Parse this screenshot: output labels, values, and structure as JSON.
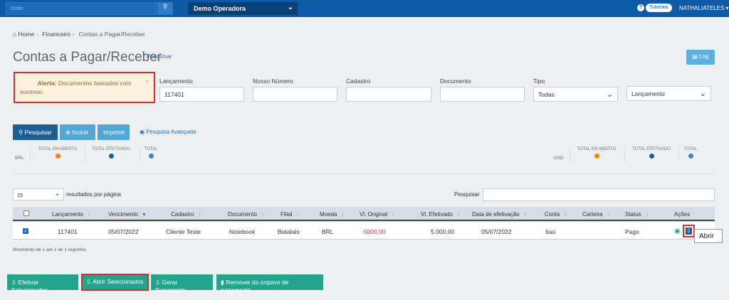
{
  "topbar": {
    "search_placeholder": "Order",
    "operadora": "Demo Operadora",
    "tutorial": "Tutoriais",
    "user": "NATHALIATELES"
  },
  "breadcrumb": [
    "Home",
    "Financeiro",
    "Contas a Pagar/Receber"
  ],
  "page": {
    "title": "Contas a Pagar/Receber",
    "pesquisar_link": "Pesquisar",
    "log_label": "Log"
  },
  "alert": {
    "strong": "Alerta:",
    "message": "Documentos baixados com",
    "message2": "sucesso."
  },
  "filters": {
    "lancamento_label": "Lançamento",
    "lancamento_value": "117401",
    "nosso_numero_label": "Nosso Número",
    "cadastro_label": "Cadastro",
    "documento_label": "Documento",
    "tipo_label": "Tipo",
    "tipo_value": "Todas",
    "ordem_value": "Lançamento"
  },
  "actions": {
    "pesquisar": "Pesquisar",
    "incluir": "Incluir",
    "imprimir": "Imprimir",
    "avancada": "Pesquisa Avançada"
  },
  "totals": {
    "brl": "BRL",
    "usd": "USD",
    "em_aberto": "TOTAL EM ABERTO",
    "efetivado": "TOTAL EFETIVADO",
    "total": "TOTAL"
  },
  "table_controls": {
    "page_size": "25",
    "per_page": "resultados por página",
    "search_label": "Pesquisar"
  },
  "table": {
    "headers": [
      "Lançamento",
      "Vencimento",
      "Cadastro",
      "Documento",
      "Filial",
      "Moeda",
      "Vl. Original",
      "Vl. Efetivado",
      "Data de efetivação",
      "Conta",
      "Carteira",
      "Status",
      "Ações"
    ],
    "row": {
      "lancamento": "117401",
      "vencimento": "05/07/2022",
      "cadastro": "Cliente Teste",
      "documento": "Notebook",
      "filial": "Batatais",
      "moeda": "BRL",
      "vl_original": "-5000,00",
      "vl_efetivado": "5.000,00",
      "data_efetivacao": "05/07/2022",
      "conta": "Itaú",
      "carteira": "",
      "status": "Pago"
    },
    "tooltip": "Abrir",
    "showing": "Mostrando de 1 até 1 de 1 registros"
  },
  "bottom": {
    "efetivar": "Efetivar Selecionados",
    "abrir": "Abrir Selecionados",
    "gerar": "Gerar Pagamento",
    "remover": "Remover do arquivo de pagamento"
  },
  "colors": {
    "topbar": "#0d5aa7",
    "primary": "#1e5e95",
    "info": "#4fa8d6",
    "success": "#22a58c",
    "highlight": "#d23030"
  }
}
